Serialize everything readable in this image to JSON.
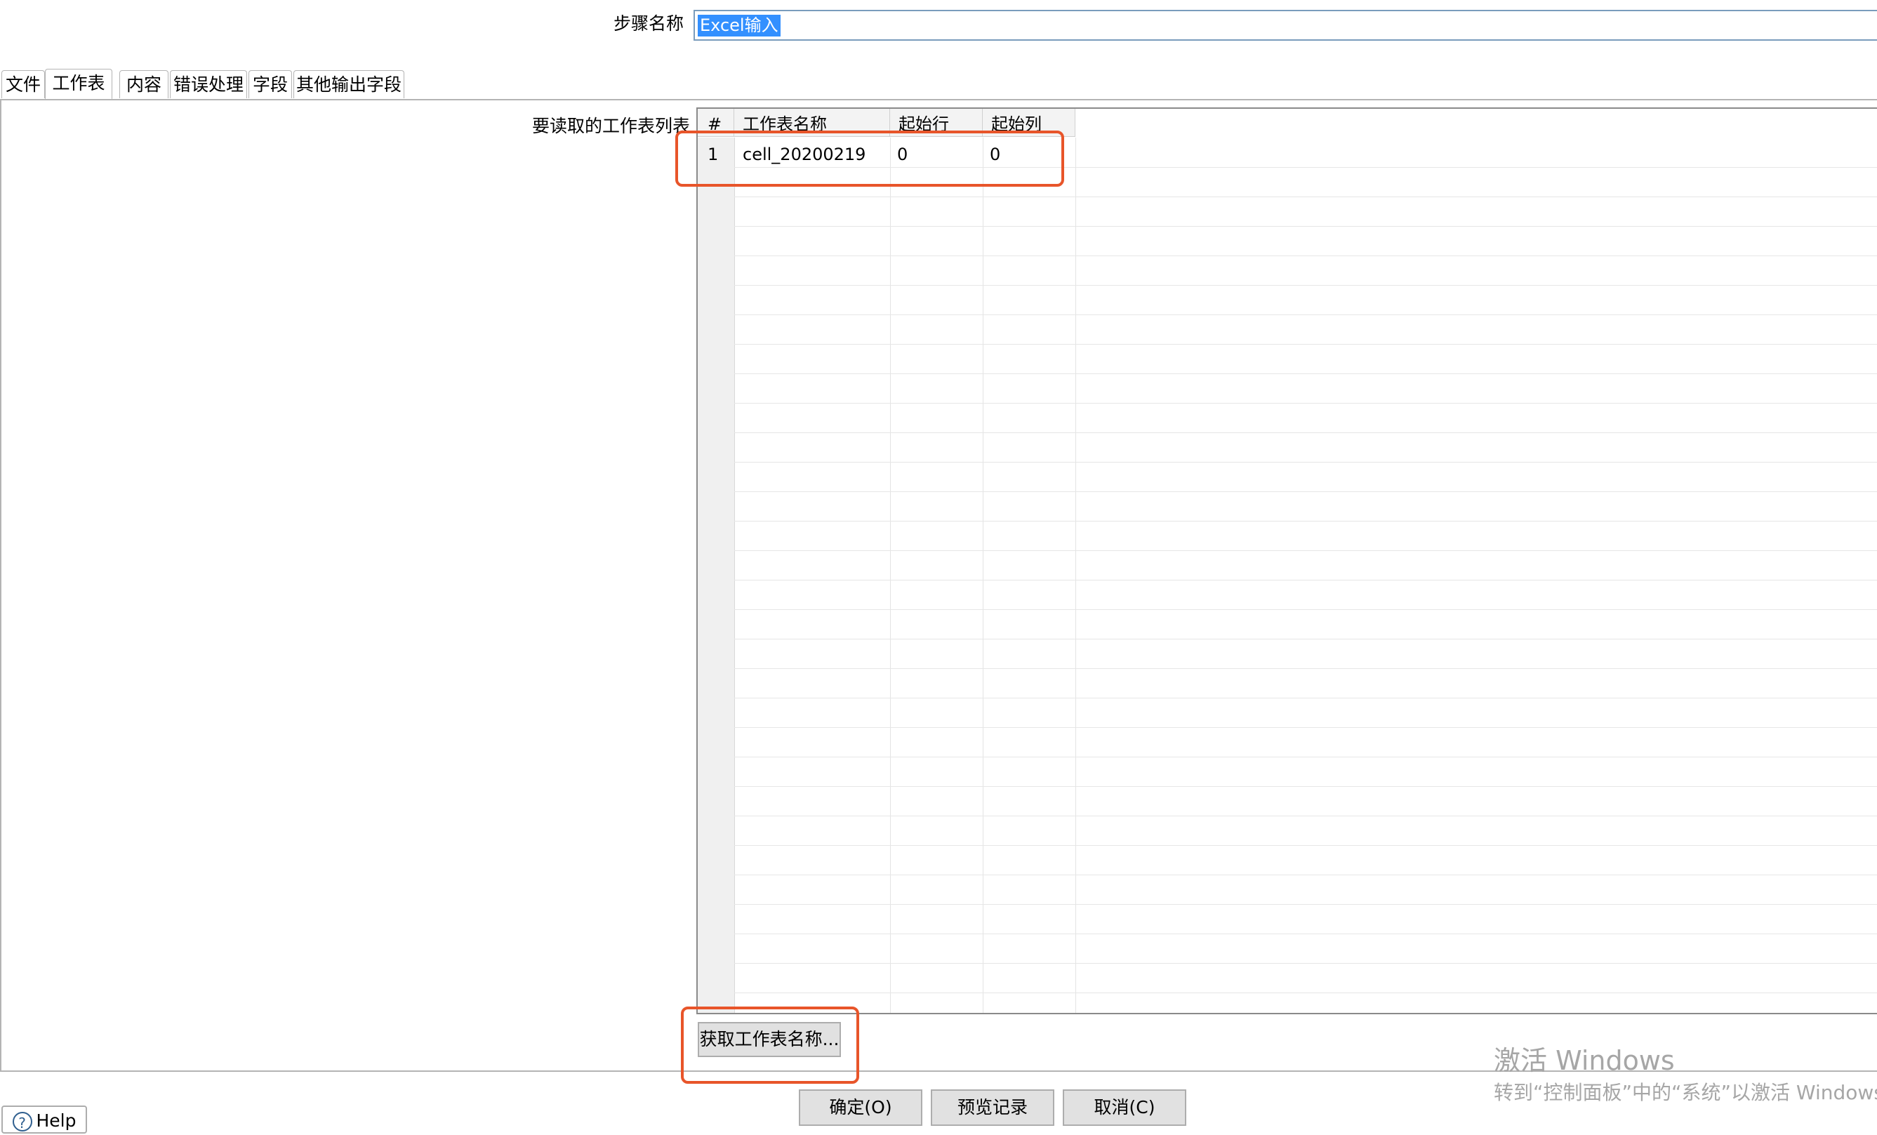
{
  "step": {
    "label": "步骤名称",
    "value": "Excel输入"
  },
  "tabs": [
    {
      "label": "文件"
    },
    {
      "label": "工作表"
    },
    {
      "label": "内容"
    },
    {
      "label": "错误处理"
    },
    {
      "label": "字段"
    },
    {
      "label": "其他输出字段"
    }
  ],
  "sheets": {
    "label": "要读取的工作表列表",
    "columns": [
      "#",
      "工作表名称",
      "起始行",
      "起始列"
    ],
    "rows": [
      {
        "num": "1",
        "name": "cell_20200219",
        "start_row": "0",
        "start_col": "0"
      }
    ]
  },
  "buttons": {
    "get_sheets": "获取工作表名称...",
    "ok": "确定(O)",
    "preview": "预览记录",
    "cancel": "取消(C)",
    "help": "Help"
  },
  "icons": {
    "help": "question-circle-icon"
  },
  "colors": {
    "highlight": "#e8552a",
    "selection": "#3390ff"
  },
  "watermark": {
    "title": "激活 Windows",
    "subtitle": "转到“控制面板”中的“系统”以激活 Windows。"
  }
}
